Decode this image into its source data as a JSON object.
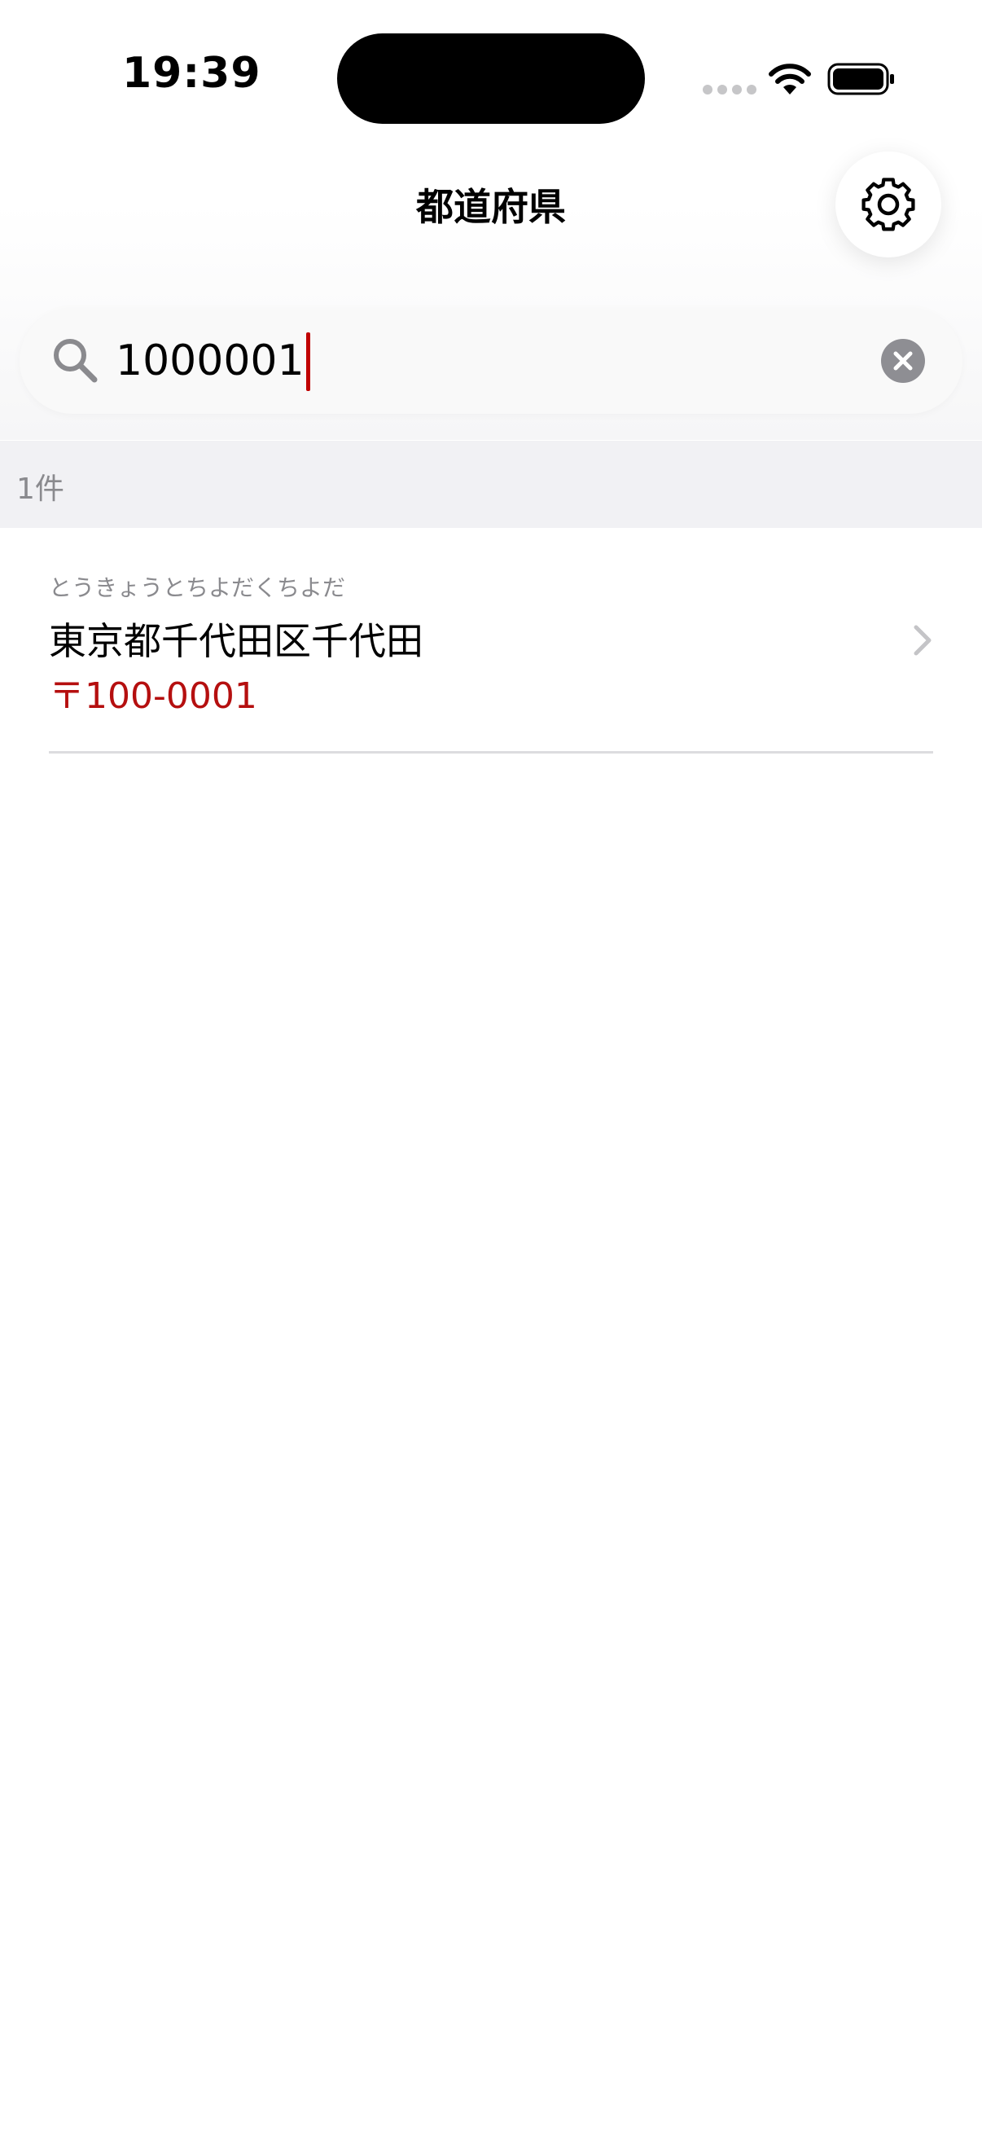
{
  "status_bar": {
    "time": "19:39"
  },
  "nav": {
    "title": "都道府県",
    "settings_icon": "gear-icon"
  },
  "search": {
    "value": "1000001",
    "placeholder": "",
    "search_icon": "search-icon",
    "clear_icon": "close-circle-icon"
  },
  "results": {
    "count_label": "1件",
    "items": [
      {
        "kana": "とうきょうとちよだくちよだ",
        "address": "東京都千代田区千代田",
        "postal": "〒100-0001"
      }
    ]
  },
  "colors": {
    "accent": "#b50f0f",
    "caret": "#c00000",
    "secondary_text": "#8a8a8e",
    "section_bg": "#f1f1f4"
  }
}
